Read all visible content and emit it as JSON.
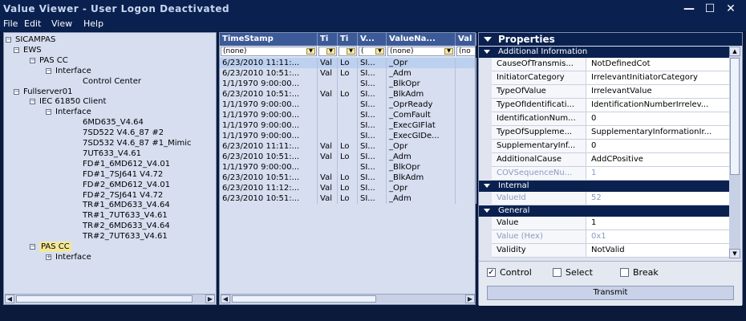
{
  "window": {
    "title": "Value Viewer - User Logon Deactivated",
    "controls": {
      "minimize": "—",
      "maximize": "☐",
      "close": "✕"
    }
  },
  "menu": {
    "items": [
      "File",
      "Edit",
      "View",
      "Help"
    ]
  },
  "tree": {
    "nodes": [
      {
        "label": "SICAMPAS",
        "level": 0,
        "expander": "−"
      },
      {
        "label": "EWS",
        "level": 1,
        "expander": "−"
      },
      {
        "label": "PAS CC",
        "level": 2,
        "expander": "−"
      },
      {
        "label": "Interface",
        "level": 3,
        "expander": "−"
      },
      {
        "label": "Control Center",
        "level": 4,
        "expander": ""
      },
      {
        "label": "Fullserver01",
        "level": 1,
        "expander": "−"
      },
      {
        "label": "IEC 61850 Client",
        "level": 2,
        "expander": "−"
      },
      {
        "label": "Interface",
        "level": 3,
        "expander": "−"
      },
      {
        "label": "6MD635_V4.64",
        "level": 4,
        "expander": ""
      },
      {
        "label": "7SD522 V4.6_87 #2",
        "level": 4,
        "expander": ""
      },
      {
        "label": "7SD532 V4.6_87 #1_Mimic",
        "level": 4,
        "expander": ""
      },
      {
        "label": "7UT633_V4.61",
        "level": 4,
        "expander": ""
      },
      {
        "label": "FD#1_6MD612_V4.01",
        "level": 4,
        "expander": ""
      },
      {
        "label": "FD#1_7SJ641 V4.72",
        "level": 4,
        "expander": ""
      },
      {
        "label": "FD#2_6MD612_V4.01",
        "level": 4,
        "expander": ""
      },
      {
        "label": "FD#2_7SJ641 V4.72",
        "level": 4,
        "expander": ""
      },
      {
        "label": "TR#1_6MD633_V4.64",
        "level": 4,
        "expander": ""
      },
      {
        "label": "TR#1_7UT633_V4.61",
        "level": 4,
        "expander": ""
      },
      {
        "label": "TR#2_6MD633_V4.64",
        "level": 4,
        "expander": ""
      },
      {
        "label": "TR#2_7UT633_V4.61",
        "level": 4,
        "expander": ""
      },
      {
        "label": "PAS CC",
        "level": 2,
        "expander": "−",
        "selected": true
      },
      {
        "label": "Interface",
        "level": 3,
        "expander": "+"
      }
    ]
  },
  "grid": {
    "columns": [
      "TimeStamp",
      "Ti",
      "Ti",
      "V...",
      "ValueNa...",
      "Val"
    ],
    "filters": [
      "(none)",
      "",
      "",
      "(",
      "(none)",
      "(no"
    ],
    "rows": [
      [
        "6/23/2010 11:11:...",
        "Val",
        "Lo",
        "SI...",
        "_Opr",
        ""
      ],
      [
        "6/23/2010 10:51:...",
        "Val",
        "Lo",
        "SI...",
        "_Adm",
        ""
      ],
      [
        "1/1/1970 9:00:00...",
        "",
        "",
        "SI...",
        "_BlkOpr",
        ""
      ],
      [
        "6/23/2010 10:51:...",
        "Val",
        "Lo",
        "SI...",
        "_BlkAdm",
        ""
      ],
      [
        "1/1/1970 9:00:00...",
        "",
        "",
        "SI...",
        "_OprReady",
        ""
      ],
      [
        "1/1/1970 9:00:00...",
        "",
        "",
        "SI...",
        "_ComFault",
        ""
      ],
      [
        "1/1/1970 9:00:00...",
        "",
        "",
        "SI...",
        "_ExecGIFlat",
        ""
      ],
      [
        "1/1/1970 9:00:00...",
        "",
        "",
        "SI...",
        "_ExecGIDe...",
        ""
      ],
      [
        "6/23/2010 11:11:...",
        "Val",
        "Lo",
        "SI...",
        "_Opr",
        ""
      ],
      [
        "6/23/2010 10:51:...",
        "Val",
        "Lo",
        "SI...",
        "_Adm",
        ""
      ],
      [
        "1/1/1970 9:00:00...",
        "",
        "",
        "SI...",
        "_BlkOpr",
        ""
      ],
      [
        "6/23/2010 10:51:...",
        "Val",
        "Lo",
        "SI...",
        "_BlkAdm",
        ""
      ],
      [
        "6/23/2010 11:12:...",
        "Val",
        "Lo",
        "SI...",
        "_Opr",
        ""
      ],
      [
        "6/23/2010 10:51:...",
        "Val",
        "Lo",
        "SI...",
        "_Adm",
        ""
      ]
    ]
  },
  "properties": {
    "title": "Properties",
    "categories": [
      {
        "name": "Additional Information",
        "rows": [
          {
            "key": "CauseOfTransmis...",
            "value": "NotDefinedCot"
          },
          {
            "key": "InitiatorCategory",
            "value": "IrrelevantInitiatorCategory"
          },
          {
            "key": "TypeOfValue",
            "value": "IrrelevantValue"
          },
          {
            "key": "TypeOfIdentificati...",
            "value": "IdentificationNumberIrrelev..."
          },
          {
            "key": "IdentificationNum...",
            "value": "0"
          },
          {
            "key": "TypeOfSuppleme...",
            "value": "SupplementaryInformationIr..."
          },
          {
            "key": "SupplementaryInf...",
            "value": "0"
          },
          {
            "key": "AdditionalCause",
            "value": "AddCPositive"
          },
          {
            "key": "COVSequenceNu...",
            "value": "1",
            "readonly": true
          }
        ]
      },
      {
        "name": "Internal",
        "rows": [
          {
            "key": "ValueId",
            "value": "52",
            "readonly": true
          }
        ]
      },
      {
        "name": "General",
        "rows": [
          {
            "key": "Value",
            "value": "1"
          },
          {
            "key": "Value (Hex)",
            "value": "0x1",
            "readonly": true
          },
          {
            "key": "Validity",
            "value": "NotValid"
          }
        ]
      }
    ],
    "checkboxes": [
      {
        "label": "Control",
        "checked": true
      },
      {
        "label": "Select",
        "checked": false
      },
      {
        "label": "Break",
        "checked": false
      }
    ],
    "transmit_label": "Transmit"
  },
  "colors": {
    "chrome": "#0a2150",
    "grid_header": "#3c5a97",
    "selection": "#bcd0ef",
    "tree_selection": "#f3e79a"
  }
}
